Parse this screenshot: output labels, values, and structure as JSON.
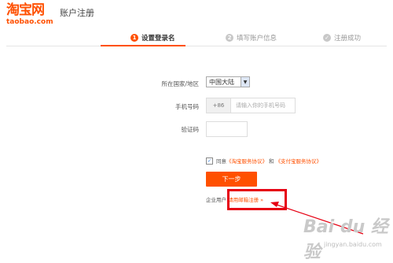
{
  "header": {
    "logo_cn": "淘宝网",
    "logo_en": "taobao.com",
    "page_title": "账户注册"
  },
  "steps": [
    {
      "num": "1",
      "label": "设置登录名"
    },
    {
      "num": "2",
      "label": "填写账户信息"
    },
    {
      "num": "✓",
      "label": "注册成功"
    }
  ],
  "form": {
    "country_label": "所在国家/地区",
    "country_value": "中国大陆",
    "phone_label": "手机号码",
    "phone_prefix": "+86",
    "phone_placeholder": "请输入你的手机号码",
    "code_label": "验证码",
    "agree_text_1": "同意",
    "agree_link_1": "《淘宝服务协议》",
    "agree_text_2": "和",
    "agree_link_2": "《支付宝服务协议》",
    "next_button": "下一步",
    "enterprise_text": "企业用户",
    "enterprise_link": "请用邮箱注册 »"
  },
  "watermark": {
    "text": "Bai du 经验",
    "sub": "jingyan.baidu.com"
  },
  "colors": {
    "brand": "#ff5000",
    "highlight": "#e60012"
  }
}
